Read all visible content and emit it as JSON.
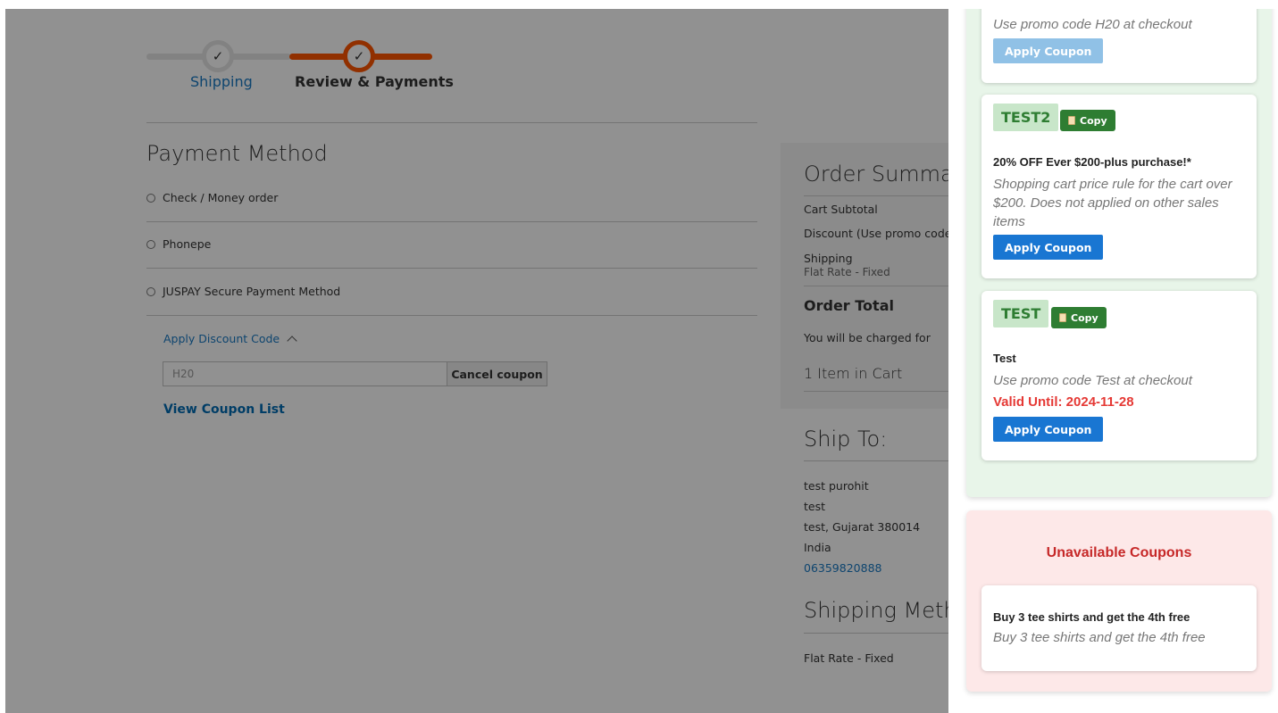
{
  "checkout": {
    "steps": [
      {
        "label": "Shipping",
        "state": "done"
      },
      {
        "label": "Review & Payments",
        "state": "active"
      }
    ],
    "payment_title": "Payment Method",
    "payment_options": [
      "Check / Money order",
      "Phonepe",
      "JUSPAY Secure Payment Method"
    ],
    "discount_toggle": "Apply Discount Code",
    "discount_value": "H20",
    "cancel_coupon": "Cancel coupon",
    "view_coupon_list": "View Coupon List"
  },
  "summary": {
    "title": "Order Summary",
    "cart_subtotal": "Cart Subtotal",
    "discount": "Discount (Use promo code H",
    "shipping": "Shipping",
    "shipping_sub": "Flat Rate - Fixed",
    "order_total": "Order Total",
    "charged": "You will be charged for",
    "items": "1 Item in Cart"
  },
  "ship_to": {
    "title": "Ship To:",
    "lines": [
      "test purohit",
      "test",
      "test, Gujarat 380014",
      "India"
    ],
    "phone": "06359820888",
    "method_title": "Shipping Metho",
    "method_value": "Flat Rate - Fixed"
  },
  "drawer": {
    "card1": {
      "desc": "Use promo code H20 at checkout",
      "apply": "Apply Coupon"
    },
    "card2": {
      "code": "TEST2",
      "copy": "Copy",
      "title": "20% OFF Ever $200-plus purchase!*",
      "desc": "Shopping cart price rule for the cart over $200. Does not applied on other sales items",
      "apply": "Apply Coupon"
    },
    "card3": {
      "code": "TEST",
      "copy": "Copy",
      "title": "Test",
      "desc": "Use promo code Test at checkout",
      "valid": "Valid Until: 2024-11-28",
      "apply": "Apply Coupon"
    },
    "unavailable_title": "Unavailable Coupons",
    "unavailable": {
      "title": "Buy 3 tee shirts and get the 4th free",
      "desc": "Buy 3 tee shirts and get the 4th free"
    }
  },
  "colors": {
    "accent_orange": "#ff5501",
    "link_blue": "#1979c3",
    "apply_blue": "#1976d2",
    "copy_green": "#2e7d32",
    "valid_red": "#e53935",
    "unavailable_red": "#c62828"
  }
}
